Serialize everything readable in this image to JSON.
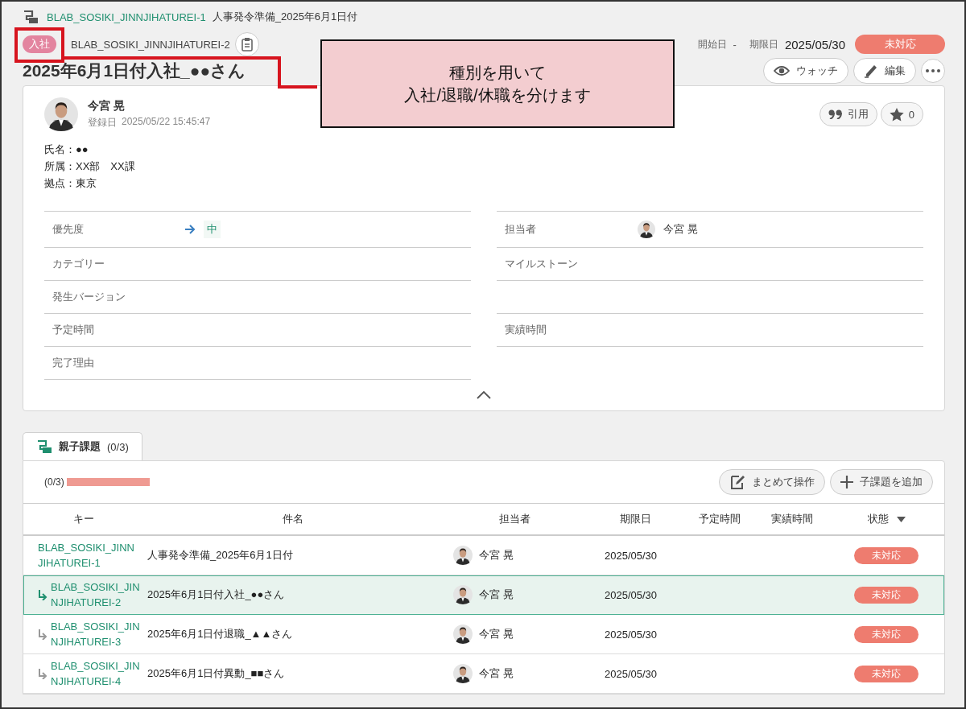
{
  "breadcrumb": {
    "key": "BLAB_SOSIKI_JINNJIHATUREI-1",
    "title": "人事発令準備_2025年6月1日付"
  },
  "issue": {
    "type_badge": {
      "label": "入社",
      "color": "#e3849f"
    },
    "key": "BLAB_SOSIKI_JINNJIHATUREI-2",
    "start_label": "開始日",
    "start_value": "-",
    "due_label": "期限日",
    "due_value": "2025/05/30",
    "status": "未対応",
    "title": "2025年6月1日付入社_●●さん"
  },
  "actions": [
    {
      "kind": "watch",
      "label": "ウォッチ"
    },
    {
      "kind": "edit",
      "label": "編集"
    },
    {
      "kind": "more"
    }
  ],
  "author": {
    "name": "今宮 晃",
    "date_label": "登録日",
    "date": "2025/05/22 15:45:47"
  },
  "reactions": [
    {
      "kind": "quote",
      "label": "引用"
    },
    {
      "kind": "star",
      "label": "0"
    }
  ],
  "description": [
    "氏名：●●",
    "所属：XX部　XX課",
    "拠点：東京"
  ],
  "properties": {
    "left": [
      {
        "label": "優先度",
        "kind": "priority",
        "value": "中"
      },
      {
        "label": "カテゴリー"
      },
      {
        "label": "発生バージョン"
      },
      {
        "label": "予定時間"
      },
      {
        "label": "完了理由"
      }
    ],
    "right": [
      {
        "label": "担当者",
        "kind": "user",
        "value": "今宮 晃"
      },
      {
        "label": "マイルストーン"
      },
      {
        "kind": "blank"
      },
      {
        "label": "実績時間"
      }
    ]
  },
  "tabs": [
    {
      "label": "親子課題",
      "count": "(0/3)",
      "selected": true
    }
  ],
  "subtasks": {
    "progress": {
      "text": "(0/3)",
      "level": 0
    },
    "buttons": [
      {
        "kind": "bulk",
        "label": "まとめて操作"
      },
      {
        "kind": "add",
        "label": "子課題を追加"
      }
    ],
    "columns": [
      "キー",
      "件名",
      "担当者",
      "期限日",
      "予定時間",
      "実績時間",
      "状態"
    ],
    "rows": [
      {
        "key": "BLAB_SOSIKI_JINNJIHATUREI-1",
        "child": false,
        "selected": false,
        "subject": "人事発令準備_2025年6月1日付",
        "assignee": "今宮 晃",
        "due": "2025/05/30",
        "status": "未対応"
      },
      {
        "key": "BLAB_SOSIKI_JINNJIHATUREI-2",
        "child": true,
        "selected": true,
        "subject": "2025年6月1日付入社_●●さん",
        "assignee": "今宮 晃",
        "due": "2025/05/30",
        "status": "未対応"
      },
      {
        "key": "BLAB_SOSIKI_JINNJIHATUREI-3",
        "child": true,
        "selected": false,
        "subject": "2025年6月1日付退職_▲▲さん",
        "assignee": "今宮 晃",
        "due": "2025/05/30",
        "status": "未対応"
      },
      {
        "key": "BLAB_SOSIKI_JINNJIHATUREI-4",
        "child": true,
        "selected": false,
        "subject": "2025年6月1日付異動_■■さん",
        "assignee": "今宮 晃",
        "due": "2025/05/30",
        "status": "未対応"
      }
    ]
  },
  "annotation": {
    "lines": [
      "種別を用いて",
      "入社/退職/休職を分けます"
    ]
  }
}
